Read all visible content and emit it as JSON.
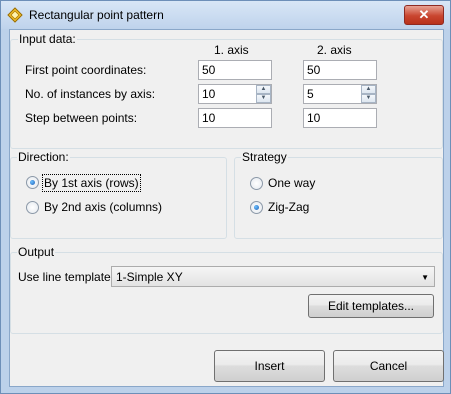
{
  "window": {
    "title": "Rectangular point pattern",
    "close_glyph": "✕"
  },
  "input": {
    "group_label": "Input data:",
    "col1": "1. axis",
    "col2": "2. axis",
    "rows": [
      {
        "label": "First point coordinates:",
        "v1": "50",
        "v2": "50"
      },
      {
        "label": "No. of instances by axis:",
        "v1": "10",
        "v2": "5"
      },
      {
        "label": "Step between points:",
        "v1": "10",
        "v2": "10"
      }
    ]
  },
  "direction": {
    "group_label": "Direction:",
    "options": [
      {
        "label": "By 1st axis (rows)",
        "selected": true
      },
      {
        "label": "By 2nd axis (columns)",
        "selected": false
      }
    ]
  },
  "strategy": {
    "group_label": "Strategy",
    "options": [
      {
        "label": "One way",
        "selected": false
      },
      {
        "label": "Zig-Zag",
        "selected": true
      }
    ]
  },
  "output": {
    "group_label": "Output",
    "template_label": "Use line template:",
    "template_value": "1-Simple XY",
    "edit_button": "Edit templates..."
  },
  "buttons": {
    "insert": "Insert",
    "cancel": "Cancel"
  },
  "icons": {
    "app": "diamond-app-icon",
    "spin_up": "spin-up-icon",
    "spin_down": "spin-down-icon",
    "dropdown": "chevron-down-icon"
  }
}
